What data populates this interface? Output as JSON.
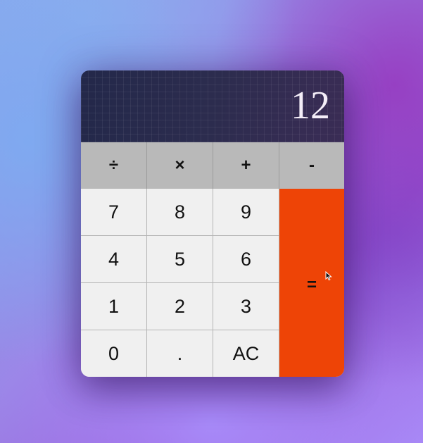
{
  "display": {
    "value": "12"
  },
  "operators": [
    {
      "label": "÷"
    },
    {
      "label": "×"
    },
    {
      "label": "+"
    },
    {
      "label": "-"
    }
  ],
  "digits": [
    [
      "7",
      "8",
      "9"
    ],
    [
      "4",
      "5",
      "6"
    ],
    [
      "1",
      "2",
      "3"
    ],
    [
      "0",
      ".",
      "AC"
    ]
  ],
  "equals": {
    "label": "="
  },
  "colors": {
    "display_bg": "#262a47",
    "operator_bg": "#b9b9b9",
    "digit_bg": "#f0f0f0",
    "equals_bg": "#ee4406",
    "display_text": "#f4eef8"
  },
  "icons": {
    "pointer": "mouse-pointer-icon"
  }
}
